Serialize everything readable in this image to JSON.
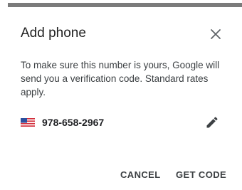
{
  "dialog": {
    "title": "Add phone",
    "body": "To make sure this number is yours, Google will send you a verification code. Standard rates apply.",
    "phone": {
      "number": "978-658-2967",
      "flag_icon": "us-flag-icon",
      "edit_icon": "pencil-icon"
    },
    "close_icon": "close-icon",
    "actions": {
      "cancel_label": "CANCEL",
      "get_code_label": "GET CODE"
    }
  },
  "colors": {
    "title": "#212121",
    "body_text": "#3c4043",
    "icon": "#5f6368",
    "top_bar": "#7b7b7b"
  }
}
